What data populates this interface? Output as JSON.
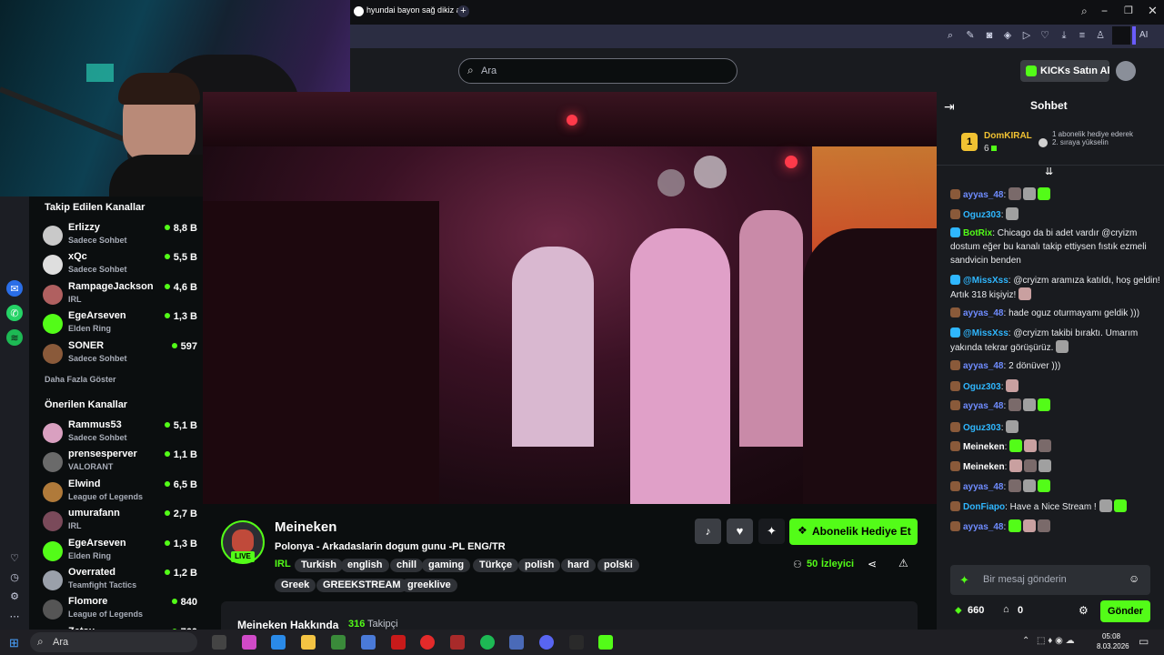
{
  "browser": {
    "tab_title": "hyundai bayon sağ dikiz a",
    "ai_label": "AI",
    "add_tab": "+"
  },
  "header": {
    "search_placeholder": "Ara",
    "kicks_button": "KICKs Satın Al"
  },
  "sidebar": {
    "followed_title": "Takip Edilen Kanallar",
    "followed": [
      {
        "name": "Erlizzy",
        "category": "Sadece Sohbet",
        "viewers": "8,8 B",
        "avatar_color": "#c9c9c9"
      },
      {
        "name": "xQc",
        "category": "Sadece Sohbet",
        "viewers": "5,5 B",
        "avatar_color": "#dedede"
      },
      {
        "name": "RampageJackson",
        "category": "IRL",
        "viewers": "4,6 B",
        "avatar_color": "#b06060"
      },
      {
        "name": "EgeArseven",
        "category": "Elden Ring",
        "viewers": "1,3 B",
        "avatar_color": "#53fc18"
      },
      {
        "name": "SONER",
        "category": "Sadece Sohbet",
        "viewers": "597",
        "avatar_color": "#8a5a3a"
      }
    ],
    "show_more": "Daha Fazla Göster",
    "suggested_title": "Önerilen Kanallar",
    "suggested": [
      {
        "name": "Rammus53",
        "category": "Sadece Sohbet",
        "viewers": "5,1 B",
        "avatar_color": "#d9a0c0"
      },
      {
        "name": "prensesperver",
        "category": "VALORANT",
        "viewers": "1,1 B",
        "avatar_color": "#6a6a6a"
      },
      {
        "name": "Elwind",
        "category": "League of Legends",
        "viewers": "6,5 B",
        "avatar_color": "#b07a3a"
      },
      {
        "name": "umurafann",
        "category": "IRL",
        "viewers": "2,7 B",
        "avatar_color": "#7a4a5a"
      },
      {
        "name": "EgeArseven",
        "category": "Elden Ring",
        "viewers": "1,3 B",
        "avatar_color": "#53fc18"
      },
      {
        "name": "Overrated",
        "category": "Teamfight Tactics",
        "viewers": "1,2 B",
        "avatar_color": "#9aa0aa"
      },
      {
        "name": "Flomore",
        "category": "League of Legends",
        "viewers": "840",
        "avatar_color": "#555555"
      },
      {
        "name": "Zetsu",
        "category": "",
        "viewers": "760",
        "avatar_color": "#777777"
      }
    ]
  },
  "stream": {
    "channel_name": "Meineken",
    "live_badge": "LIVE",
    "title": "Polonya - Arkadaslarin dogum gunu -PL ENG/TR",
    "category": "IRL",
    "tags_row1": [
      "Turkish",
      "english",
      "chill",
      "gaming",
      "Türkçe",
      "polish",
      "hard",
      "polski"
    ],
    "tags_row2": [
      "Greek",
      "GREEKSTREAM",
      "greeklive"
    ],
    "viewer_count": "50",
    "viewer_label": "İzleyici",
    "gift_button": "Abonelik Hediye Et",
    "about_title": "Meineken Hakkında",
    "followers_count": "316",
    "followers_label": "Takipçi"
  },
  "chat": {
    "title": "Sohbet",
    "top_gifter_rank": "1",
    "top_gifter_name": "DomKIRAL",
    "top_gifter_count": "6",
    "gift_hint": "1 abonelik hediye ederek 2. sıraya yükselin",
    "messages": [
      {
        "user": "ayyas_48",
        "color": "#6f8cff",
        "text": "",
        "emotes": 3
      },
      {
        "user": "Oguz303",
        "color": "#2fb7ff",
        "text": "",
        "emotes": 1
      },
      {
        "user": "BotRix",
        "color": "#53fc18",
        "text": "Chicago da bi adet vardır @cryizm dostum eğer bu kanalı takip ettiysen fıstık ezmeli sandvicin benden",
        "emotes": 0
      },
      {
        "user": "@MissXss",
        "color": "#2fb7ff",
        "text": "@cryizm aramıza katıldı, hoş geldin! Artık 318 kişiyiz!",
        "emotes": 1
      },
      {
        "user": "ayyas_48",
        "color": "#6f8cff",
        "text": "hade oguz oturmayamı geldik )))",
        "emotes": 0
      },
      {
        "user": "@MissXss",
        "color": "#2fb7ff",
        "text": "@cryizm takibi bıraktı. Umarım yakında tekrar görüşürüz.",
        "emotes": 1
      },
      {
        "user": "ayyas_48",
        "color": "#6f8cff",
        "text": "2 dönüver )))",
        "emotes": 0
      },
      {
        "user": "Oguz303",
        "color": "#2fb7ff",
        "text": "",
        "emotes": 1
      },
      {
        "user": "ayyas_48",
        "color": "#6f8cff",
        "text": "",
        "emotes": 3
      },
      {
        "user": "Oguz303",
        "color": "#2fb7ff",
        "text": "",
        "emotes": 1
      },
      {
        "user": "Meineken",
        "color": "#ffffff",
        "text": "",
        "emotes": 3
      },
      {
        "user": "Meineken",
        "color": "#ffffff",
        "text": "",
        "emotes": 3
      },
      {
        "user": "ayyas_48",
        "color": "#6f8cff",
        "text": "",
        "emotes": 3
      },
      {
        "user": "DonFiapo",
        "color": "#2fb7ff",
        "text": "Have a Nice Stream !",
        "emotes": 2
      },
      {
        "user": "ayyas_48",
        "color": "#6f8cff",
        "text": "",
        "emotes": 3
      }
    ],
    "input_placeholder": "Bir mesaj gönderin",
    "kicks_count": "660",
    "gifts_count": "0",
    "send_button": "Gönder"
  },
  "taskbar": {
    "search_label": "Ara",
    "time": "05:08",
    "date": "8.03.2026"
  },
  "colors": {
    "accent": "#53fc18",
    "chat_bg": "#191b1f",
    "page_bg": "#0b0e0f"
  }
}
